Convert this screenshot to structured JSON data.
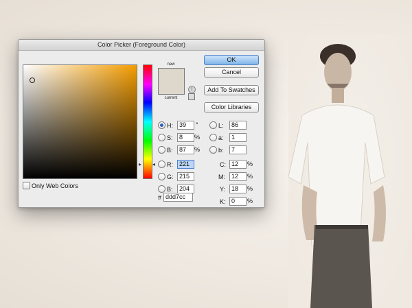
{
  "dialog": {
    "title": "Color Picker (Foreground Color)",
    "new_label": "new",
    "current_label": "current",
    "new_color": "#ddd7cc",
    "current_color": "#ddd7cc"
  },
  "buttons": {
    "ok": "OK",
    "cancel": "Cancel",
    "add_to_swatches": "Add To Swatches",
    "color_libraries": "Color Libraries"
  },
  "hsb": {
    "h_label": "H:",
    "h_value": "39",
    "h_unit": "°",
    "s_label": "S:",
    "s_value": "8",
    "s_unit": "%",
    "b_label": "B:",
    "b_value": "87",
    "b_unit": "%"
  },
  "rgb": {
    "r_label": "R:",
    "r_value": "221",
    "g_label": "G:",
    "g_value": "215",
    "b_label": "B:",
    "b_value": "204"
  },
  "lab": {
    "l_label": "L:",
    "l_value": "86",
    "a_label": "a:",
    "a_value": "1",
    "b_label": "b:",
    "b_value": "7"
  },
  "cmyk": {
    "c_label": "C:",
    "c_value": "12",
    "c_unit": "%",
    "m_label": "M:",
    "m_value": "12",
    "m_unit": "%",
    "y_label": "Y:",
    "y_value": "18",
    "y_unit": "%",
    "k_label": "K:",
    "k_value": "0",
    "k_unit": "%"
  },
  "hex": {
    "prefix": "#",
    "value": "ddd7cc"
  },
  "web_only_label": "Only Web Colors",
  "colors": {
    "accent": "#2d5fbf",
    "field_hue": "#f39c00"
  }
}
